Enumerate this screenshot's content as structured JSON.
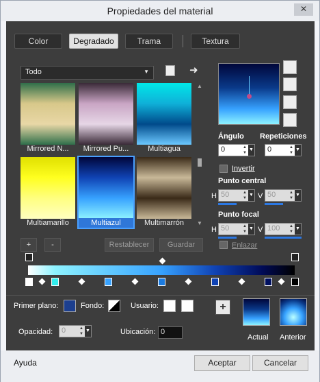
{
  "title": "Propiedades del material",
  "tabs": [
    "Color",
    "Degradado",
    "Trama",
    "Textura"
  ],
  "category_dropdown": "Todo",
  "gradients": [
    {
      "label": "Mirrored N...",
      "colors": [
        "#2f6f4a",
        "#d8c88a",
        "#e8d7a6",
        "#2f6f4a"
      ]
    },
    {
      "label": "Mirrored Pu...",
      "colors": [
        "#3a2a38",
        "#c9a5c4",
        "#e6d6e6",
        "#3a2a38"
      ]
    },
    {
      "label": "Multiagua",
      "colors": [
        "#00e8e8",
        "#0fb0d8",
        "#004a8a",
        "#6cc8ff"
      ]
    },
    {
      "label": "Multiamarillo",
      "colors": [
        "#e0e000",
        "#ffff20",
        "#ffff80",
        "#ffffc0"
      ]
    },
    {
      "label": "Multiazul",
      "colors": [
        "#00063a",
        "#1043b4",
        "#37a2ff",
        "#8ef3ff"
      ]
    },
    {
      "label": "Multimarrón",
      "colors": [
        "#3a2a18",
        "#c8b898",
        "#3a2a18",
        "#c8b898"
      ]
    }
  ],
  "buttons": {
    "add": "+",
    "remove": "-",
    "reset": "Restablecer",
    "save": "Guardar",
    "accept": "Aceptar",
    "cancel": "Cancelar",
    "help": "Ayuda",
    "plus": "+"
  },
  "angle": {
    "label": "Ángulo",
    "value": "0"
  },
  "repeats": {
    "label": "Repeticiones",
    "value": "0"
  },
  "invert": "Invertir",
  "center": {
    "label": "Punto central",
    "h_label": "H",
    "h": "50",
    "v_label": "V",
    "v": "50"
  },
  "focal": {
    "label": "Punto focal",
    "h_label": "H",
    "h": "50",
    "v_label": "V",
    "v": "100"
  },
  "link": "Enlazar",
  "bottom": {
    "foreground": "Primer plano:",
    "background": "Fondo:",
    "user": "Usuario:",
    "opacity_label": "Opacidad:",
    "opacity": "0",
    "location_label": "Ubicación:",
    "location": "0",
    "current": "Actual",
    "previous": "Anterior"
  },
  "close": "✕"
}
